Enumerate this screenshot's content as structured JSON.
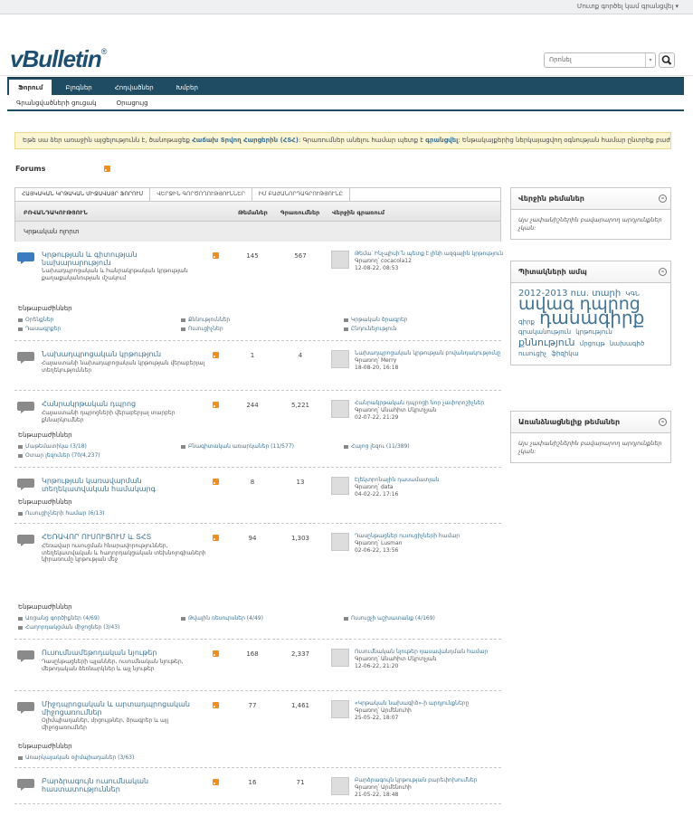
{
  "top": {
    "login": "Մուտք գործել կամ գրանցվել"
  },
  "logo": {
    "text": "vBulletin",
    "reg": "®"
  },
  "search": {
    "placeholder": "Որոնել"
  },
  "nav": {
    "tabs": [
      "Ֆորում",
      "Բլոգներ",
      "Հոդվածներ",
      "Խմբեր"
    ],
    "subtabs": [
      "Գրանցվածների ցուցակ",
      "Օրացույց"
    ]
  },
  "notice": {
    "pre": "Եթե սա ձեր առաջին այցելությունն է, ծանոթացեք ",
    "link1": "Հաճախ Տրվող Հարցերին (ՀՏՀ)",
    "mid": ": Գրառումներ անելու համար պետք է ",
    "link2": "գրանցվել",
    "post": ": Ենթակայքերից ներկայացվող օգնության համար ընտրեք բաժինը:"
  },
  "forums_title": "Forums",
  "main_tabs": [
    "ՀԱՅԿԱԿԱՆ ԿՐԹԱԿԱՆ ՄԻՋԱՎԱՅՐ ՖՈՐՈՒՄ",
    "ՎԵՐՋԻՆ ԳՈՐԾՈՂՈՒԹՅՈՒՆՆԵՐ",
    "ԻՄ ԲԱԺԱՆՈՐԴԱԳՐՈՒԹՅՈՒՆԸ"
  ],
  "columns": {
    "title": "ԲՈՎԱՆԴԱԿՈՒԹՅՈՒՆ",
    "threads": "Թեմաներ",
    "posts": "Գրառումներ",
    "last": "Վերջին գրառում"
  },
  "category": "Կրթական ոլորտ",
  "subforums_label": "Ենթաբաժիններ",
  "forums": [
    {
      "name": "Կրթության և գիտության նախարարություն",
      "desc": "Նախադպրոցական և հանրակրթական կրթության քաղաքականության մշակում",
      "threads": "145",
      "posts": "567",
      "lp_title": "Թեմա՝ Ինչպիսի՞ն պետք է լինի ազգային կրթությունը",
      "lp_by": "Գրառող՝ cocacola12",
      "lp_date": "12-08-22, 08:53",
      "subs": [
        "Օրենքներ",
        "Քննություններ",
        "Կրթական ծրագրեր",
        "Դասագրքեր",
        "Ուսուցիչներ",
        "Ընդունելություն"
      ]
    },
    {
      "name": "Նախադպրոցական կրթություն",
      "desc": "Հայաստանի նախադպրոցական կրթության վերաբերյալ տեղեկություններ",
      "threads": "1",
      "posts": "4",
      "lp_title": "Նախադպրոցական կրթության բովանդակությունը",
      "lp_by": "Գրառող՝ Merry",
      "lp_date": "18-08-20, 16:18",
      "subs": []
    },
    {
      "name": "Հանրակրթական դպրոց",
      "desc": "Հայաստանի դպրոցների վերաբերյալ տարբեր քննարկումներ",
      "threads": "244",
      "posts": "5,221",
      "lp_title": "Հանրակրթական դպրոցի նոր չափորոշիչներ",
      "lp_by": "Գրառող՝ Անահիտ Մկրտչյան",
      "lp_date": "02-07-22, 21:29",
      "subs": [
        "Մաթեմատիկա (3/18)",
        "Բնագիտական առարկաներ (11/577)",
        "Հայոց լեզու (11/389)",
        "Օտար լեզուներ (70/4,237)"
      ]
    },
    {
      "name": "Կրթության կառավարման տեղեկատվական համակարգ",
      "desc": "",
      "threads": "8",
      "posts": "13",
      "lp_title": "Էլեկտրոնային դասամատյան",
      "lp_by": "Գրառող՝ data",
      "lp_date": "04-02-22, 17:16",
      "subs": [
        "Ուսուցիչների համար (6/13)"
      ]
    },
    {
      "name": "ՀԵՌԱՎՈՐ ՈՒՍՈՒՑՈՒՄ և ՏՀՏ",
      "desc": "Հեռավար ուսուցման հնարավորություններ, տեղեկատվական և հաղորդակցական տեխնոլոգիաների կիրառումը կրթության մեջ",
      "threads": "94",
      "posts": "1,303",
      "lp_title": "Դասընթացներ ուսուցիչների համար",
      "lp_by": "Գրառող՝ Lusman",
      "lp_date": "02-06-22, 13:56",
      "subs": [
        "Առցանց գործիքներ (4/69)",
        "Թվային ռեսուրսներ (4/49)",
        "Ուսուցչի աշխատանք (4/169)",
        "Հաղորդակցման միջոցներ (3/43)"
      ]
    },
    {
      "name": "Ուսումնամեթոդական նյութեր",
      "desc": "Դասընթացների պլաններ, ուսումնական նյութեր, մեթոդական ձեռնարկներ և այլ նյութեր",
      "threads": "168",
      "posts": "2,337",
      "lp_title": "Ուսումնական նյութեր դասավանդման համար",
      "lp_by": "Գրառող՝ Անահիտ Մկրտչյան",
      "lp_date": "12-06-22, 21:20",
      "subs": []
    },
    {
      "name": "Միջդպրոցական և արտադպրոցական միջոցառումներ",
      "desc": "Օլիմպիադաներ, մրցույթներ, ծրագրեր և այլ միջոցառումներ",
      "threads": "77",
      "posts": "1,461",
      "lp_title": "«Կրթական նախագիծ»-ի արդյունքները",
      "lp_by": "Գրառող՝ Արմենուհի",
      "lp_date": "25-05-22, 18:07",
      "subs": [
        "Առարկայական օլիմպիադաներ (3/63)"
      ]
    },
    {
      "name": "Բարձրագույն ուսումնական հաստատություններ",
      "desc": "",
      "threads": "16",
      "posts": "71",
      "lp_title": "Բարձրագույն կրթության բարեփոխումներ",
      "lp_by": "Գրառող՝ Արմենուհի",
      "lp_date": "21-05-22, 18:48",
      "subs": []
    }
  ],
  "side": {
    "recent_title": "Վերջին թեմաներ",
    "recent_empty": "Այս չափանիշներին բավարարող արդյունքներ չկան:",
    "tags_title": "Պիտակների ամպ",
    "tags": [
      {
        "t": "2012-2013 ուս. տարի",
        "s": 10
      },
      {
        "t": "ԿԳՆ",
        "s": 7
      },
      {
        "t": "ավագ դպրոց",
        "s": 19
      },
      {
        "t": "գիրք",
        "s": 7
      },
      {
        "t": "դասագիրք",
        "s": 20
      },
      {
        "t": "գրականություն",
        "s": 7
      },
      {
        "t": "կրթություն",
        "s": 7
      },
      {
        "t": "քննություն",
        "s": 11
      },
      {
        "t": "մրցույթ",
        "s": 7
      },
      {
        "t": "նախագիծ",
        "s": 7
      },
      {
        "t": "ուսուցիչ",
        "s": 7
      },
      {
        "t": "ֆիզիկա",
        "s": 7
      }
    ],
    "featured_title": "Առանձնացնելիք թեմաներ",
    "featured_empty": "Այս չափանիշներին բավարարող արդյունքներ չկան:"
  }
}
